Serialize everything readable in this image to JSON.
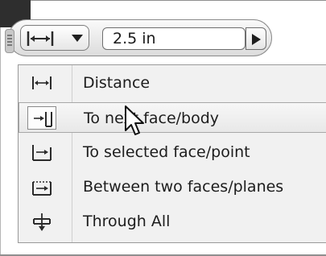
{
  "toolbar": {
    "mode_icon": "distance-icon",
    "dropdown_icon": "chevron-down-icon",
    "value": "2.5 in",
    "apply_icon": "play-arrow-icon"
  },
  "menu": {
    "items": [
      {
        "label": "Distance",
        "icon": "distance-icon"
      },
      {
        "label": "To next face/body",
        "icon": "to-next-face-icon"
      },
      {
        "label": "To selected face/point",
        "icon": "to-selected-face-icon"
      },
      {
        "label": "Between two faces/planes",
        "icon": "between-faces-icon"
      },
      {
        "label": "Through All",
        "icon": "through-all-icon"
      }
    ],
    "hovered_index": 1
  },
  "colors": {
    "icon_stroke": "#2b2b2b",
    "menu_bg": "#f1f1f1",
    "hover_border": "#a8a8a8"
  }
}
